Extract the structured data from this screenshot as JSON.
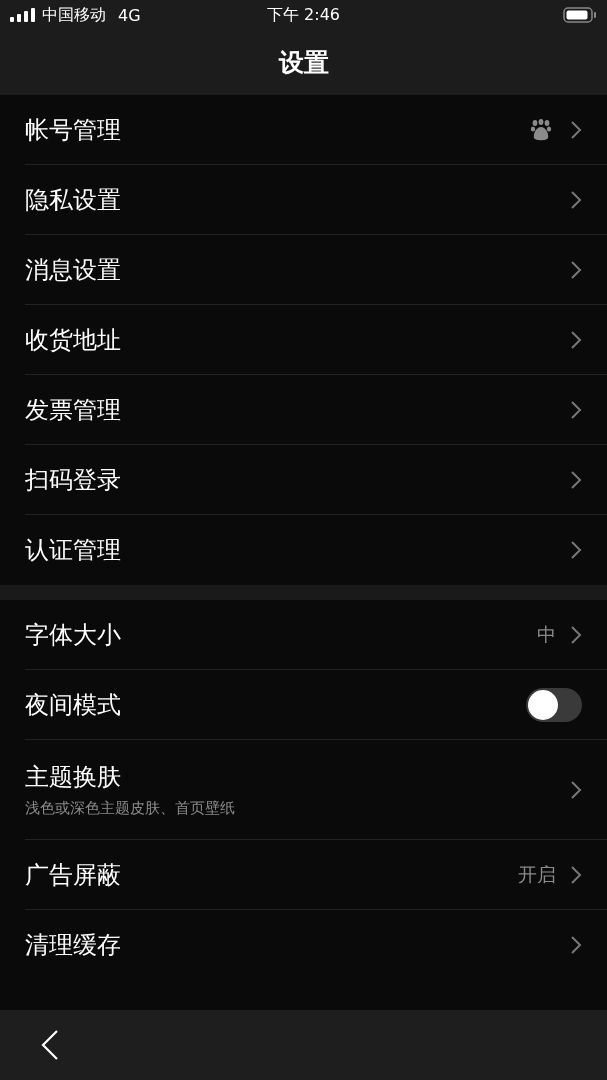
{
  "status_bar": {
    "carrier": "中国移动",
    "network": "4G",
    "time": "下午 2:46"
  },
  "nav": {
    "title": "设置"
  },
  "groups": [
    {
      "items": [
        {
          "kind": "link_icon",
          "label": "帐号管理"
        },
        {
          "kind": "link",
          "label": "隐私设置"
        },
        {
          "kind": "link",
          "label": "消息设置"
        },
        {
          "kind": "link",
          "label": "收货地址"
        },
        {
          "kind": "link",
          "label": "发票管理"
        },
        {
          "kind": "link",
          "label": "扫码登录"
        },
        {
          "kind": "link",
          "label": "认证管理"
        }
      ]
    },
    {
      "items": [
        {
          "kind": "link",
          "label": "字体大小",
          "value": "中"
        },
        {
          "kind": "toggle",
          "label": "夜间模式",
          "on": false
        },
        {
          "kind": "link",
          "label": "主题换肤",
          "subtitle": "浅色或深色主题皮肤、首页壁纸"
        },
        {
          "kind": "link",
          "label": "广告屏蔽",
          "value": "开启"
        },
        {
          "kind": "link",
          "label": "清理缓存"
        }
      ]
    }
  ]
}
